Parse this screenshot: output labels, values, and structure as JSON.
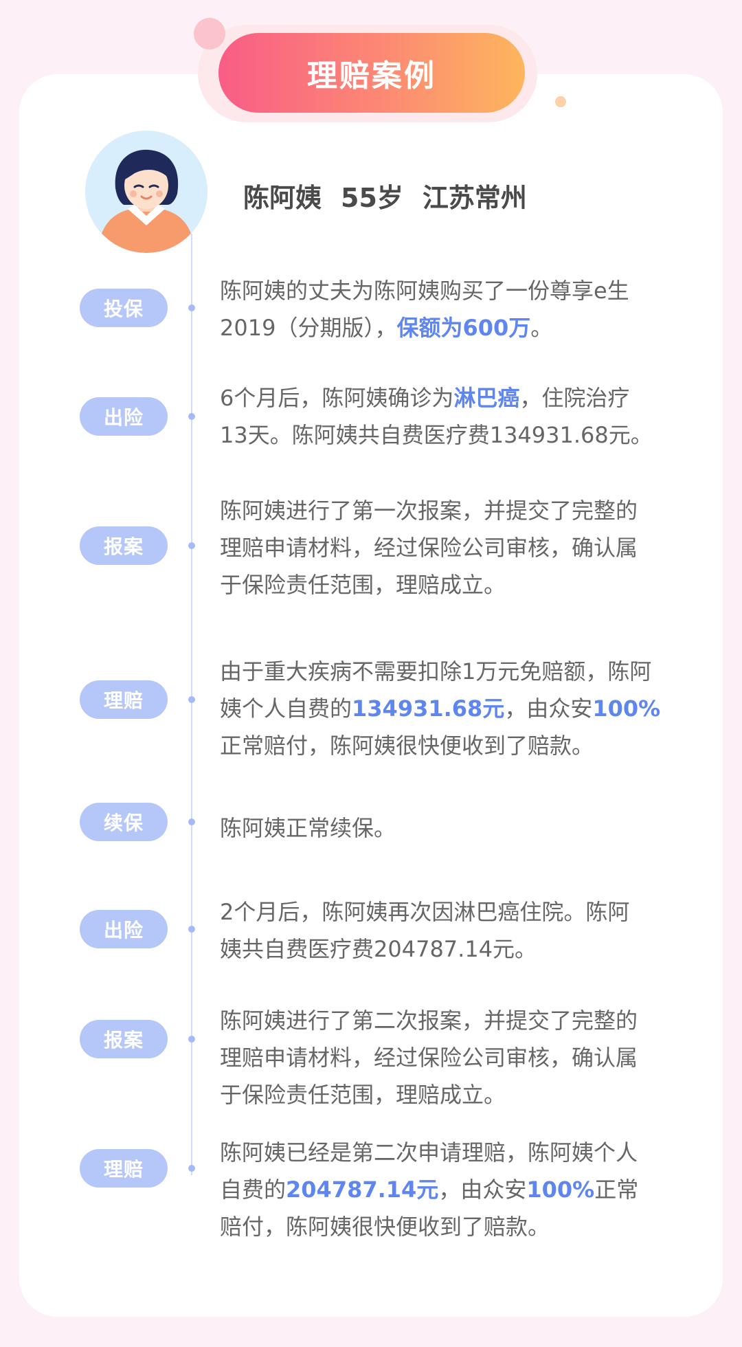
{
  "header": {
    "title": "理赔案例"
  },
  "profile": {
    "name": "陈阿姨",
    "age": "55岁",
    "location": "江苏常州"
  },
  "colors": {
    "tag_bg": "#b5c6f9",
    "highlight": "#5e86ee",
    "gradient_start": "#f95d86",
    "gradient_end": "#fdb65d"
  },
  "timeline": [
    {
      "tag": "投保",
      "lines": [
        [
          {
            "t": "陈阿姨的丈夫为陈阿姨购买了一份尊享e生"
          }
        ],
        [
          {
            "t": "2019（分期版），"
          },
          {
            "t": "保额为600万",
            "hl": true
          },
          {
            "t": "。"
          }
        ]
      ]
    },
    {
      "tag": "出险",
      "lines": [
        [
          {
            "t": "6个月后，陈阿姨确诊为"
          },
          {
            "t": "淋巴癌",
            "hl": true
          },
          {
            "t": "，住院治疗"
          }
        ],
        [
          {
            "t": "13天。陈阿姨共自费医疗费134931.68元。"
          }
        ]
      ]
    },
    {
      "tag": "报案",
      "lines": [
        [
          {
            "t": "陈阿姨进行了第一次报案，并提交了完整的"
          }
        ],
        [
          {
            "t": "理赔申请材料，经过保险公司审核，确认属"
          }
        ],
        [
          {
            "t": "于保险责任范围，理赔成立。"
          }
        ]
      ]
    },
    {
      "tag": "理赔",
      "lines": [
        [
          {
            "t": "由于重大疾病不需要扣除1万元免赔额，陈阿"
          }
        ],
        [
          {
            "t": "姨个人自费的"
          },
          {
            "t": "134931.68元",
            "hl": true
          },
          {
            "t": "，由众安"
          },
          {
            "t": "100%",
            "hl": true
          }
        ],
        [
          {
            "t": "正常赔付，陈阿姨很快便收到了赔款。"
          }
        ]
      ]
    },
    {
      "tag": "续保",
      "lines": [
        [
          {
            "t": "陈阿姨正常续保。"
          }
        ]
      ]
    },
    {
      "tag": "出险",
      "lines": [
        [
          {
            "t": "2个月后，陈阿姨再次因淋巴癌住院。陈阿"
          }
        ],
        [
          {
            "t": "姨共自费医疗费204787.14元。"
          }
        ]
      ]
    },
    {
      "tag": "报案",
      "lines": [
        [
          {
            "t": "陈阿姨进行了第二次报案，并提交了完整的"
          }
        ],
        [
          {
            "t": "理赔申请材料，经过保险公司审核，确认属"
          }
        ],
        [
          {
            "t": "于保险责任范围，理赔成立。"
          }
        ]
      ]
    },
    {
      "tag": "理赔",
      "lines": [
        [
          {
            "t": "陈阿姨已经是第二次申请理赔，陈阿姨个人"
          }
        ],
        [
          {
            "t": "自费的"
          },
          {
            "t": "204787.14元",
            "hl": true
          },
          {
            "t": "，由众安"
          },
          {
            "t": "100%",
            "hl": true
          },
          {
            "t": "正常"
          }
        ],
        [
          {
            "t": "赔付，陈阿姨很快便收到了赔款。"
          }
        ]
      ]
    }
  ]
}
